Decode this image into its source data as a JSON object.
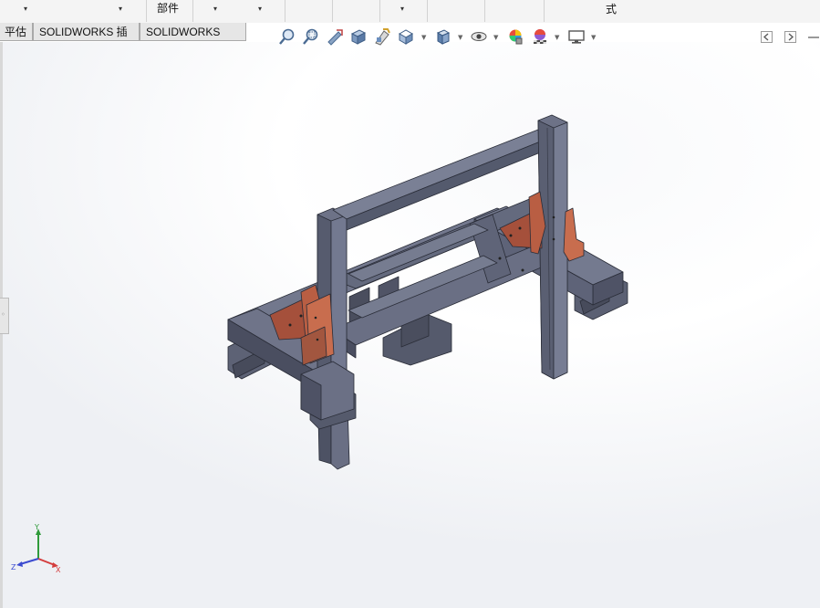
{
  "ribbon": {
    "items": [
      {
        "text": "部件"
      },
      {
        "text": "式"
      }
    ]
  },
  "tabs": [
    {
      "label": "平估"
    },
    {
      "label": "SOLIDWORKS 插件"
    },
    {
      "label": "SOLIDWORKS MBD"
    }
  ],
  "heads_up_toolbar": {
    "icons": [
      "zoom-to-fit-icon",
      "zoom-to-area-icon",
      "previous-view-icon",
      "section-view-icon",
      "dynamic-annotation-icon",
      "view-orientation-icon",
      "display-style-icon",
      "hide-show-items-icon",
      "edit-appearance-icon",
      "apply-scene-icon",
      "view-settings-icon"
    ]
  },
  "colors": {
    "frame": "#5f6478",
    "frame_dark": "#3b3f4f",
    "frame_light": "#7c8196",
    "bracket": "#a5503b",
    "bracket_light": "#c86d4e",
    "triad_x": "#d43d3d",
    "triad_y": "#2f9a3a",
    "triad_z": "#3b4bd0"
  },
  "triad": {
    "x_label": "X",
    "y_label": "Y",
    "z_label": "Z"
  }
}
